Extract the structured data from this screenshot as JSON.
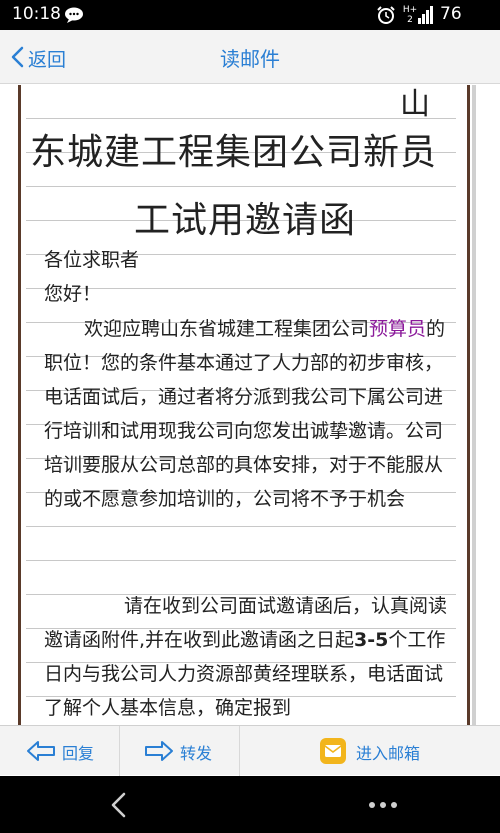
{
  "status_bar": {
    "time": "10:18",
    "network_label_top": "H+",
    "network_label_bottom": "2",
    "battery": "76",
    "icons": [
      "chat-bubble-icon",
      "alarm-icon",
      "signal-icon"
    ]
  },
  "nav": {
    "back_label": "返回",
    "title": "读邮件",
    "accent_color": "#2a7fd4"
  },
  "document": {
    "title_fragment": "山",
    "title_line1": "东城建工程集团公司新员",
    "title_line2": "工试用邀请函",
    "greeting": "各位求职者",
    "hello": "您好！",
    "para1_part1": "欢迎应聘山东省城建工程集团公司",
    "para1_highlight": "预算员",
    "para1_part2": "的职位！您的条件基本通过了人力部的初步审核，电话面试后，通过者将分派到我公司下属公司进行培训和试用现我公司向您发出诚挚邀请。公司培训要服从公司总部的具体安排，对于不能服从的或不愿意参加培训的，公司将不予于机会",
    "para2_part1": "请在收到公司面试邀请函后，认真阅读邀请函附件,并在收到此邀请函之日起",
    "para2_bold": "3-5",
    "para2_part2": "个工作日内与我公司人力资源部黄经理联系，电话面试了解个人基本信息，确定报到",
    "highlight_color": "#8b1a9a"
  },
  "actions": {
    "reply": "回复",
    "forward": "转发",
    "inbox": "进入邮箱"
  }
}
